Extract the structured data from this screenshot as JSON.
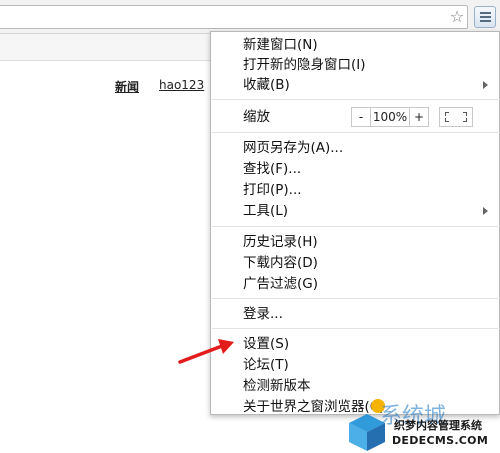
{
  "page": {
    "links": [
      "新闻",
      "hao123"
    ]
  },
  "menu": {
    "new_window": "新建窗口(N)",
    "new_incognito": "打开新的隐身窗口(I)",
    "bookmarks": "收藏(B)",
    "zoom_label": "缩放",
    "zoom_minus": "-",
    "zoom_value": "100%",
    "zoom_plus": "+",
    "save_as": "网页另存为(A)...",
    "find": "查找(F)...",
    "print": "打印(P)...",
    "tools": "工具(L)",
    "history": "历史记录(H)",
    "downloads": "下载内容(D)",
    "ad_filter": "广告过滤(G)",
    "login": "登录...",
    "settings": "设置(S)",
    "forum": "论坛(T)",
    "check_update": "检测新版本",
    "about": "关于世界之窗浏览器(C)"
  },
  "watermark": {
    "brand": "系统城",
    "line1": "织梦内容管理系统",
    "line2": "DEDECMS.COM"
  },
  "icons": {
    "star": "star-icon",
    "menu": "hamburger-menu-icon",
    "fullscreen": "fullscreen-icon"
  }
}
